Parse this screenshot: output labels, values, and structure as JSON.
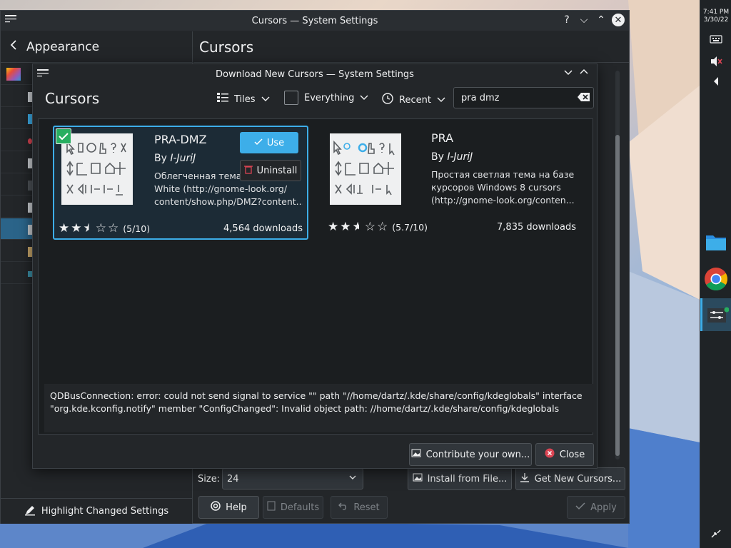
{
  "panel": {
    "time": "7:41 PM",
    "date": "3/30/22",
    "icons": [
      "keyboard-icon",
      "volume-muted-icon",
      "expand-arrow-icon",
      "folder-icon",
      "chrome-icon",
      "settings-app-icon",
      "desktop-toggle-icon"
    ]
  },
  "main_window": {
    "title": "Cursors — System Settings",
    "sidebar": {
      "back_label": "Appearance",
      "highlight_label": "Highlight Changed Settings"
    },
    "page_title": "Cursors",
    "size_label": "Size:",
    "size_value": "24",
    "install_file_label": "Install from File...",
    "get_new_label": "Get New Cursors...",
    "help_label": "Help",
    "defaults_label": "Defaults",
    "reset_label": "Reset",
    "apply_label": "Apply"
  },
  "dialog": {
    "title": "Download New Cursors — System Settings",
    "heading": "Cursors",
    "view_mode": "Tiles",
    "filter": "Everything",
    "sort": "Recent",
    "search_value": "pra dmz",
    "items": [
      {
        "title": "PRA-DMZ",
        "author_prefix": "By",
        "author": "I-JuriJ",
        "desc1": "Облегченная тема",
        "desc2": "White (http://gnome-look.org/",
        "desc3": "content/show.php/DMZ?content...",
        "rating_text": "(5/10)",
        "rating": 5,
        "downloads": "4,564 downloads",
        "use_label": "Use",
        "uninstall_label": "Uninstall"
      },
      {
        "title": "PRA",
        "author_prefix": "By",
        "author": "I-JuriJ",
        "desc1": "Простая светлая тема на базе",
        "desc2": "курсоров Windows 8 cursors",
        "desc3": "(http://gnome-look.org/conten...",
        "rating_text": "(5.7/10)",
        "rating": 5.7,
        "downloads": "7,835 downloads"
      }
    ],
    "error_line1": "QDBusConnection: error: could not send signal to service \"\" path \"//home/dartz/.kde/share/config/kdeglobals\" interface",
    "error_line2": "\"org.kde.kconfig.notify\" member \"ConfigChanged\": Invalid object path: //home/dartz/.kde/share/config/kdeglobals",
    "contribute_label": "Contribute your own...",
    "close_label": "Close"
  },
  "colors": {
    "accent": "#3daee9",
    "selection": "#2b6489",
    "window_bg": "#232629",
    "close_red": "#da4453"
  }
}
